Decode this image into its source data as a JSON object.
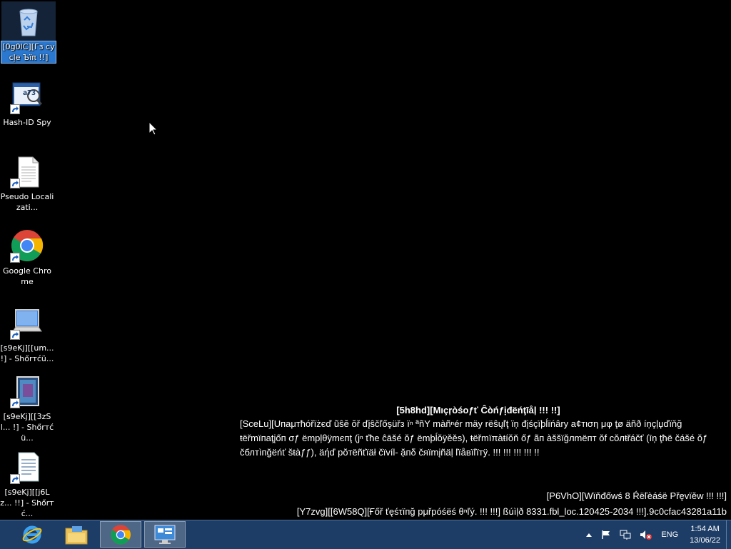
{
  "desktop_icons": [
    {
      "name": "recycle-bin",
      "label": "[0g0lC][Гз сусļе Ъïπ !!]"
    },
    {
      "name": "hash-id-spy",
      "label": "Hash-ID Spy"
    },
    {
      "name": "pseudo-localization",
      "label": "Pseudo Localizati..."
    },
    {
      "name": "google-chrome",
      "label": "Google Chrome"
    },
    {
      "name": "shortcut-um",
      "label": "[s9eKj][[um... !] - Shőrтćü..."
    },
    {
      "name": "shortcut-3zsl",
      "label": "[s9eKj][[3zSl... !] - Shőrтćü..."
    },
    {
      "name": "shortcut-j6lz",
      "label": "[s9eKj][[j6Lz... !!] - Shőrтć..."
    }
  ],
  "hash_icon_text": "a73",
  "watermark": {
    "title": "[5h8hd][Mıçŗòśoƒť Ĉòńƒịđëńţīåļ !!! !!]",
    "body": "[SceLu][Uпаμтħóřïżєď ũŝĕ ŏř ďįŝčľőşüřз ïⁿ ªñY màñⁿér mäy rëŝųľţ ïņ đįśçïþĺïńâry a¢тιση μφ ţø äñð íņçļџďïňğ ŧëřmïпаţįőп σƒ ëmpļθÿmєпţ (jⁿ ťħe ĉāšé ŏƒ ёmþĺŏÿĕěs), ŧёřmïπàŧíŏň őƒ ãп àššïğлmëпт ŏf сŏлŧřáčť (īņ ţħё čášé ŏƒ čблтìпğёńť šŧàƒƒ), äήď pŏтëñťïäł čïvíl- ặпδ čяïmįñäļ ľïåвïľïтÿ. !!! !!! !!! !!! !!",
    "build": "[P6VhO][Wïňđőwś 8 Ŕёľèáśë Přęvïěw !!! !!!]",
    "build2": "[Y7zvg][[6W58Q][Ғőř ťęśτïпğ pμřpóśëś θⁿľý. !!! !!!] ßúìļð 8331.fbl_loc.120425-2034 !!!].9c0cfac43281a11b"
  },
  "taskbar": {
    "apps": [
      {
        "name": "internet-explorer",
        "active": false
      },
      {
        "name": "file-explorer",
        "active": false
      },
      {
        "name": "google-chrome",
        "active": true
      },
      {
        "name": "remote-desktop",
        "active": false
      }
    ],
    "language": "ENG",
    "time": "1:54 AM",
    "date": "13/06/22"
  },
  "colors": {
    "desktop_bg": "#000000",
    "taskbar_bg": "#1e3d66",
    "selection": "#2a78d0"
  }
}
